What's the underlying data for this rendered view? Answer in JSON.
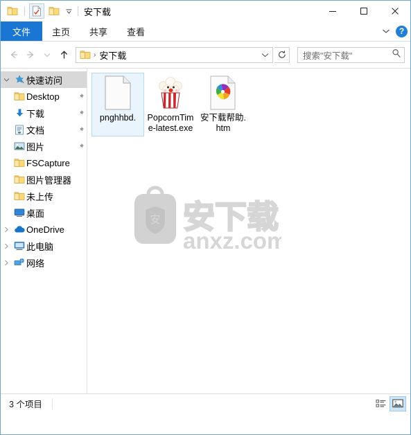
{
  "window": {
    "title": "安下载",
    "accent_blue": "#1976d2",
    "border_color": "#6fa8c9"
  },
  "quick_access_toolbar": {
    "items": [
      {
        "name": "folder-icon",
        "label": ""
      },
      {
        "name": "properties-icon",
        "label": ""
      },
      {
        "name": "new-folder-icon",
        "label": ""
      }
    ],
    "customize_caret": "▾"
  },
  "window_controls": {
    "minimize": "—",
    "maximize": "▢",
    "close": "✕"
  },
  "ribbon": {
    "tabs": [
      {
        "label": "文件",
        "selected": true
      },
      {
        "label": "主页",
        "selected": false
      },
      {
        "label": "共享",
        "selected": false
      },
      {
        "label": "查看",
        "selected": false
      }
    ],
    "expand_caret": "⌄",
    "help_label": "?"
  },
  "addressbar": {
    "back": "←",
    "forward": "→",
    "history": "⌄",
    "up": "↑",
    "breadcrumb_separator": "›",
    "path": "安下载",
    "dropdown_caret": "⌄",
    "refresh": "↻"
  },
  "search": {
    "placeholder": "搜索\"安下载\"",
    "icon": "search-icon"
  },
  "sidebar": {
    "items": [
      {
        "label": "快速访问",
        "icon": "star-pin-icon",
        "level": 1,
        "expander": "⌄",
        "selected": true,
        "pinned": false
      },
      {
        "label": "Desktop",
        "icon": "folder-icon",
        "level": 2,
        "expander": "",
        "selected": false,
        "pinned": true
      },
      {
        "label": "下载",
        "icon": "download-icon",
        "level": 2,
        "expander": "",
        "selected": false,
        "pinned": true
      },
      {
        "label": "文档",
        "icon": "documents-icon",
        "level": 2,
        "expander": "",
        "selected": false,
        "pinned": true
      },
      {
        "label": "图片",
        "icon": "pictures-icon",
        "level": 2,
        "expander": "",
        "selected": false,
        "pinned": true
      },
      {
        "label": "FSCapture",
        "icon": "folder-icon",
        "level": 2,
        "expander": "",
        "selected": false,
        "pinned": false
      },
      {
        "label": "图片管理器",
        "icon": "folder-icon",
        "level": 2,
        "expander": "",
        "selected": false,
        "pinned": false
      },
      {
        "label": "未上传",
        "icon": "folder-icon",
        "level": 2,
        "expander": "",
        "selected": false,
        "pinned": false
      },
      {
        "label": "桌面",
        "icon": "desktop-icon",
        "level": 2,
        "expander": "",
        "selected": false,
        "pinned": false
      },
      {
        "label": "OneDrive",
        "icon": "cloud-icon",
        "level": 1,
        "expander": "›",
        "selected": false,
        "pinned": false
      },
      {
        "label": "此电脑",
        "icon": "computer-icon",
        "level": 1,
        "expander": "›",
        "selected": false,
        "pinned": false
      },
      {
        "label": "网络",
        "icon": "network-icon",
        "level": 1,
        "expander": "›",
        "selected": false,
        "pinned": false
      }
    ]
  },
  "files": [
    {
      "name": "pnghhbd.",
      "icon": "blank-document-icon",
      "selected": true
    },
    {
      "name": "PopcornTime-latest.exe",
      "icon": "popcorn-icon",
      "selected": false
    },
    {
      "name": "安下载帮助.htm",
      "icon": "html-document-icon",
      "selected": false
    }
  ],
  "watermark": {
    "logo_char": "安",
    "brand_text": "安下载",
    "site_text": "anxz.com",
    "color": "#d4d4d4"
  },
  "statusbar": {
    "item_count_text": "3 个项目",
    "views": [
      {
        "name": "details-view-button",
        "active": false
      },
      {
        "name": "large-icons-view-button",
        "active": true
      }
    ]
  }
}
